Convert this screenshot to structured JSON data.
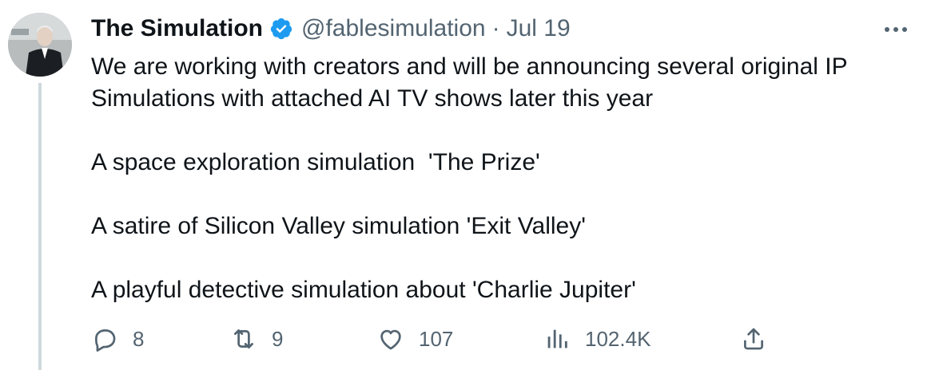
{
  "tweet": {
    "display_name": "The Simulation",
    "handle": "@fablesimulation",
    "separator": "·",
    "date": "Jul 19",
    "paragraphs": [
      "We are working with creators and will be announcing several original IP",
      "Simulations with attached AI TV shows later this year",
      "A space exploration simulation  'The Prize'",
      "A satire of Silicon Valley simulation 'Exit Valley'",
      "A playful detective simulation about 'Charlie Jupiter'"
    ],
    "metrics": {
      "replies": "8",
      "reposts": "9",
      "likes": "107",
      "views": "102.4K"
    }
  },
  "colors": {
    "text": "#0f1419",
    "muted": "#536471",
    "verified": "#1d9bf0",
    "thread_line": "#cfd9de"
  },
  "icons": [
    "verified-badge-icon",
    "more-icon",
    "reply-icon",
    "repost-icon",
    "like-icon",
    "views-icon",
    "share-icon"
  ]
}
